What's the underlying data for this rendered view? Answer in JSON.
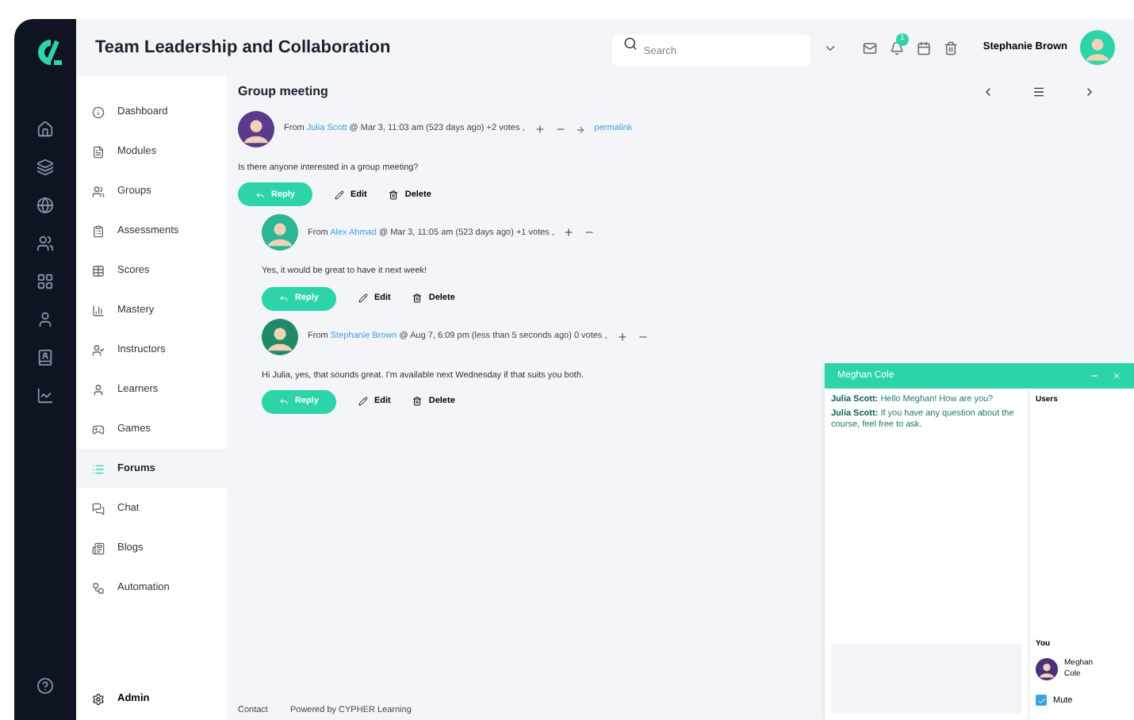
{
  "header": {
    "title": "Team Leadership and Collaboration",
    "search": {
      "placeholder": "Search"
    },
    "notification_count": "1",
    "user_name": "Stephanie Brown"
  },
  "nav": {
    "items": [
      {
        "label": "Dashboard",
        "selected": false
      },
      {
        "label": "Modules",
        "selected": false
      },
      {
        "label": "Groups",
        "selected": false
      },
      {
        "label": "Assessments",
        "selected": false
      },
      {
        "label": "Scores",
        "selected": false
      },
      {
        "label": "Mastery",
        "selected": false
      },
      {
        "label": "Instructors",
        "selected": false
      },
      {
        "label": "Learners",
        "selected": false
      },
      {
        "label": "Games",
        "selected": false
      },
      {
        "label": "Forums",
        "selected": true
      },
      {
        "label": "Chat",
        "selected": false
      },
      {
        "label": "Blogs",
        "selected": false
      },
      {
        "label": "Automation",
        "selected": false
      }
    ],
    "admin": "Admin"
  },
  "thread": {
    "title": "Group meeting",
    "posts": [
      {
        "indent": false,
        "author": "Julia Scott",
        "meta_before": "From",
        "meta_after": "@ Mar 3, 11:03 am (523 days ago) +2 votes ,",
        "permalink": "permalink",
        "body": "Is there anyone interested in a group meeting?",
        "reply": "Reply",
        "edit": "Edit",
        "delete": "Delete"
      },
      {
        "indent": true,
        "author": "Alex Ahmad",
        "meta_before": "From",
        "meta_after": "@ Mar 3, 11:05 am (523 days ago) +1 votes ,",
        "body": "Yes, it would be great to have it next week!",
        "reply": "Reply",
        "edit": "Edit",
        "delete": "Delete"
      },
      {
        "indent": true,
        "author": "Stephanie Brown",
        "meta_before": "From",
        "meta_after": "@ Aug 7, 6:09 pm (less than 5 seconds ago) 0 votes ,",
        "body": "Hi Julia, yes, that sounds great. I'm available next Wednesday if that suits you both.",
        "reply": "Reply",
        "edit": "Edit",
        "delete": "Delete"
      }
    ]
  },
  "footer": {
    "links": [
      "Contact",
      "Powered by CYPHER Learning"
    ]
  },
  "chat": {
    "title": "Meghan Cole",
    "messages": [
      {
        "sender": "Julia Scott:",
        "text": "Hello Meghan! How are you?"
      },
      {
        "sender": "Julia Scott:",
        "text": "If you have any question about the course, feel free to ask."
      }
    ],
    "users_heading": "Users",
    "you_heading": "You",
    "you_name": "Meghan Cole",
    "mute": {
      "label": "Mute",
      "checked": true
    }
  }
}
